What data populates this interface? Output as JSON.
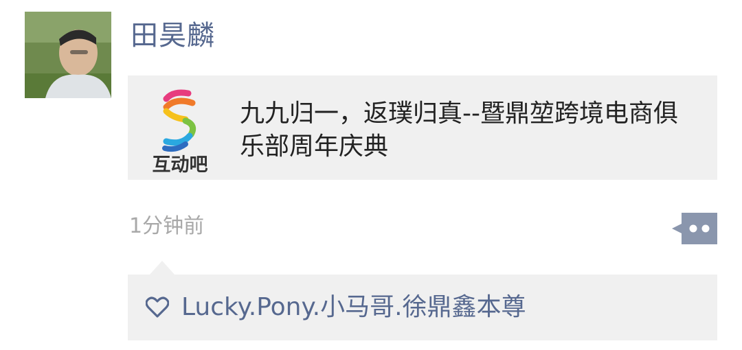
{
  "post": {
    "author": "田昊麟",
    "time": "1分钟前"
  },
  "share": {
    "thumb_label": "互动吧",
    "title": "九九归一，返璞归真--暨鼎堃跨境电商俱乐部周年庆典"
  },
  "likes": {
    "names": "Lucky.Pony.小马哥.徐鼎鑫本尊"
  },
  "icons": {
    "avatar": "user-photo",
    "thumb": "hudongba-logo-icon",
    "comment": "more-dots-icon",
    "like": "heart-outline-icon"
  },
  "colors": {
    "name_link": "#56688f",
    "timestamp": "#a8a8a8",
    "card_bg": "#f0f0f0",
    "comment_btn": "#8a96ad"
  }
}
